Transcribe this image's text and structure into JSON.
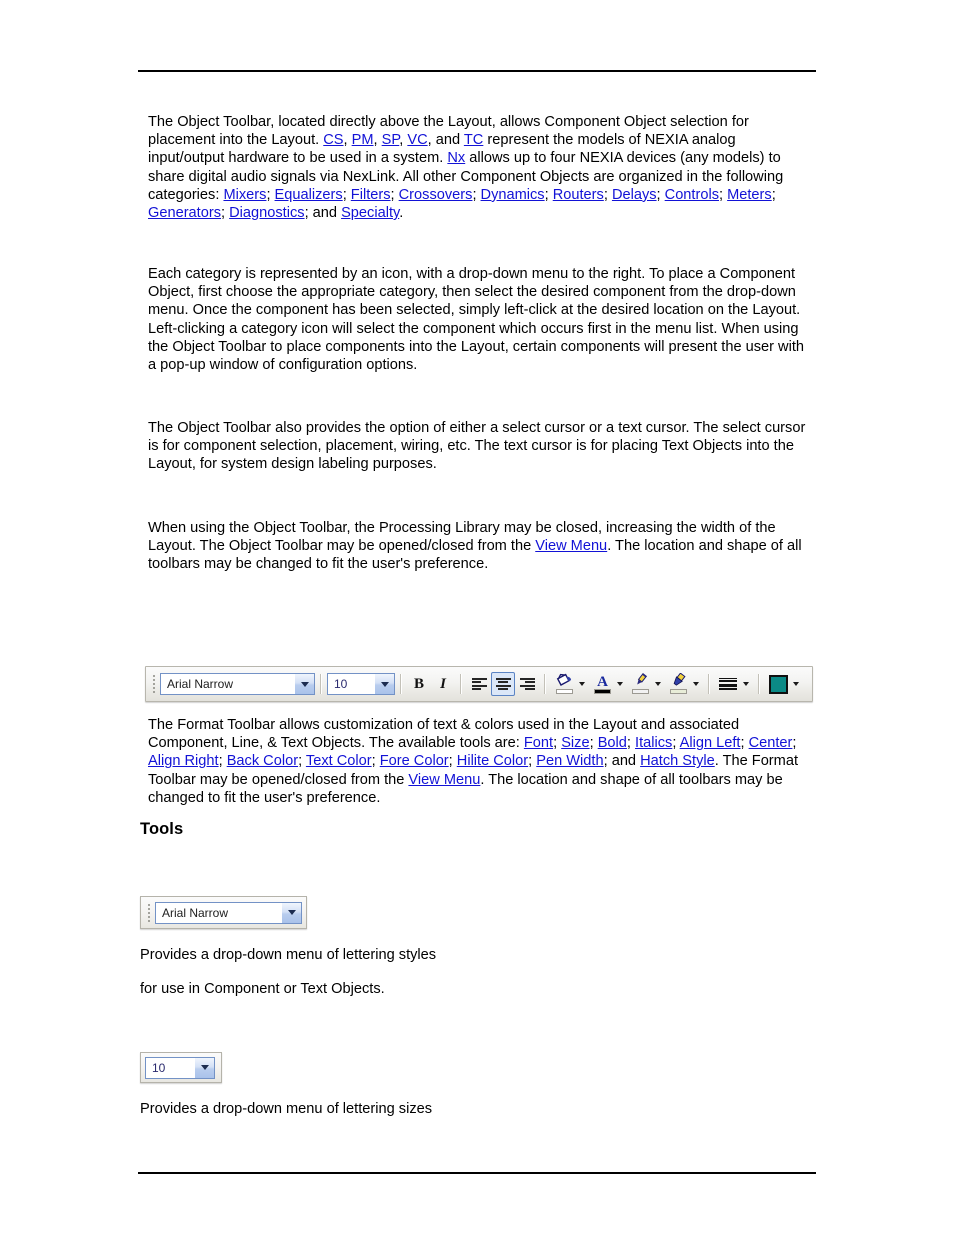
{
  "document": {
    "heading_tools": "Tools",
    "paragraphs": {
      "p1": {
        "s1": "The Object Toolbar, located directly above the Layout, allows Component Object selection for placement into the Layout. ",
        "l_cs": "CS",
        "s2": ", ",
        "l_pm": "PM",
        "s3": ", ",
        "l_sp": "SP",
        "s4": ", ",
        "l_vc": "VC",
        "s5": ", and ",
        "l_tc": "TC",
        "s6": " represent the models of NEXIA analog input/output hardware to be used in a system. ",
        "l_nx": "Nx",
        "s7": " allows up to four NEXIA devices (any models) to share digital audio signals via NexLink. All other Component Objects are organized in the following categories: ",
        "l_mixers": "Mixers",
        "s8": "; ",
        "l_equalizers": "Equalizers",
        "s9": "; ",
        "l_filters": "Filters",
        "s10": "; ",
        "l_crossovers": "Crossovers",
        "s11": "; ",
        "l_dynamics": "Dynamics",
        "s12": "; ",
        "l_routers": "Routers",
        "s13": "; ",
        "l_delays": "Delays",
        "s14": "; ",
        "l_controls": "Controls",
        "s15": "; ",
        "l_meters": "Meters",
        "s16": "; ",
        "l_generators": "Generators",
        "s17": "; ",
        "l_diagnostics": "Diagnostics",
        "s18": "; and ",
        "l_specialty": "Specialty",
        "s19": "."
      },
      "p2": "Each category is represented by an icon, with a drop-down menu to the right. To place a Component Object, first choose the appropriate category, then select the desired component from the drop-down menu. Once the component has been selected, simply left-click at the desired location on the Layout. Left-clicking a category icon will select the component which occurs first in the menu list. When using the Object Toolbar to place components into the Layout, certain components will present the user with a pop-up window of configuration options.",
      "p3": "The Object Toolbar also provides the option of either a select cursor or a text cursor. The select cursor is for component selection, placement, wiring, etc. The text cursor is for placing Text Objects into the Layout, for system design labeling purposes.",
      "p4": {
        "s1": "When using the Object Toolbar, the Processing Library may be closed, increasing the width of the Layout. The Object Toolbar may be opened/closed from the ",
        "l_view_menu": "View Menu",
        "s2": ". The location and shape of all toolbars may be changed to fit the user's preference."
      },
      "p5": {
        "s1": "The Format Toolbar allows customization of text & colors used in the Layout and associated Component, Line, & Text Objects. The available tools are: ",
        "l_font": "Font",
        "s2": "; ",
        "l_size": "Size",
        "s3": "; ",
        "l_bold": "Bold",
        "s4": "; ",
        "l_italics": "Italics",
        "s5": "; ",
        "l_align_left": "Align Left",
        "s6": "; ",
        "l_center": "Center",
        "s7": "; ",
        "l_align_right": "Align Right",
        "s8": "; ",
        "l_back_color": "Back Color",
        "s9": "; ",
        "l_text_color": "Text Color",
        "s10": "; ",
        "l_fore_color": "Fore Color",
        "s11": "; ",
        "l_hilite_color": "Hilite Color",
        "s12": "; ",
        "l_pen_width": "Pen Width",
        "s13": "; and ",
        "l_hatch_style": "Hatch Style",
        "s14": ". The Format Toolbar may be opened/closed from the ",
        "l_view_menu": "View Menu",
        "s15": ". The location and shape of all toolbars may be changed to fit the user's preference."
      },
      "t1": "Provides a drop-down menu of lettering styles",
      "t2": "for use in Component or Text Objects.",
      "t3": "Provides a drop-down menu of lettering sizes"
    }
  },
  "format_toolbar": {
    "font_combo": {
      "value": "Arial Narrow",
      "placeholder": "Arial Narrow"
    },
    "size_combo": {
      "value": "10",
      "placeholder": "10"
    },
    "buttons": {
      "bold": "B",
      "italic": "I"
    },
    "icons": {
      "align_left": "align-left-icon",
      "align_center": "align-center-icon",
      "align_right": "align-right-icon",
      "back_color": "paint-bucket-icon",
      "text_color": "font-color-A-icon",
      "fore_color": "pen-icon",
      "hilite_color": "highlighter-icon",
      "pen_width": "line-width-icon",
      "hatch_style": "hatch-swatch-icon"
    },
    "swatches": {
      "back_color": "#ffffff",
      "text_color": "#000000",
      "fore_color": "#f2f2f2",
      "hilite_color": "#e8edd8",
      "hatch_style": "#0b8a86"
    },
    "active_button": "align-center"
  },
  "tool_widgets": {
    "font_widget": {
      "value": "Arial Narrow"
    },
    "size_widget": {
      "value": "10"
    }
  },
  "colors": {
    "link": "#1212d6",
    "text": "#000000",
    "rule": "#000000",
    "toolbar_bg": "#f0efea",
    "combo_border": "#7392c6"
  }
}
